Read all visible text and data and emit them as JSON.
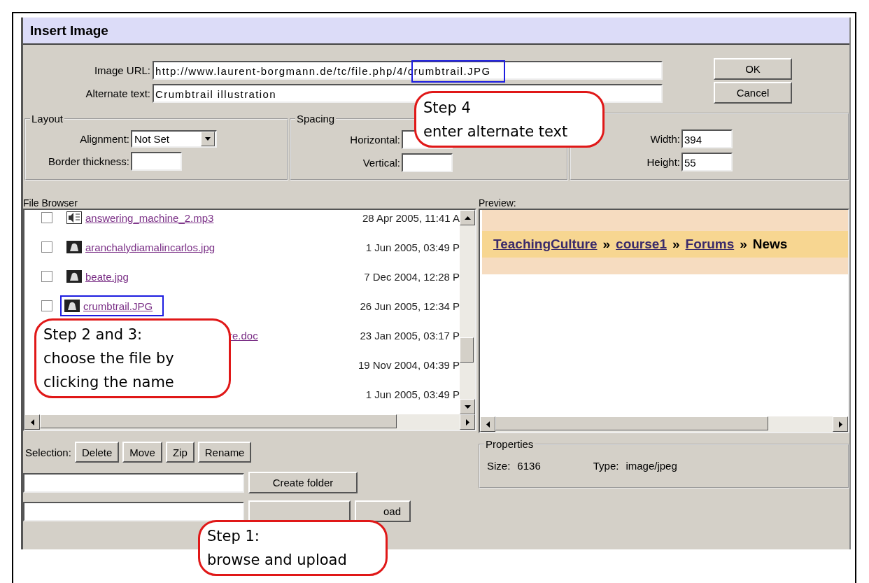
{
  "window": {
    "title": "Insert Image"
  },
  "image_url": {
    "label": "Image URL:",
    "value": "http://www.laurent-borgmann.de/tc/file.php/4/crumbtrail.JPG"
  },
  "alternate_text": {
    "label": "Alternate text:",
    "value": "Crumbtrail illustration"
  },
  "buttons": [
    "OK",
    "Cancel"
  ],
  "layout": {
    "legend": "Layout",
    "alignment_label": "Alignment:",
    "alignment_value": "Not Set",
    "border_label": "Border thickness:"
  },
  "spacing": {
    "legend": "Spacing",
    "horizontal_label": "Horizontal:",
    "vertical_label": "Vertical:"
  },
  "size": {
    "width_label": "Width:",
    "width_value": "394",
    "height_label": "Height:",
    "height_value": "55"
  },
  "file_browser": {
    "label": "File Browser",
    "files": [
      {
        "kind": "audio",
        "name": "answering_machine_2.mp3",
        "date": "28 Apr 2005, 11:41 A",
        "checked": false
      },
      {
        "kind": "image",
        "name": "aranchalydiamalincarlos.jpg",
        "date": "1 Jun 2005, 03:49 P",
        "checked": false
      },
      {
        "kind": "image",
        "name": "beate.jpg",
        "date": "7 Dec 2004, 12:28 P",
        "checked": false
      },
      {
        "kind": "image",
        "name": "crumbtrail.JPG",
        "date": "26 Jun 2005, 12:34 P",
        "checked": false,
        "highlighted": true
      },
      {
        "name": "re.doc",
        "date": "23 Jan 2005, 03:17 P",
        "covered": true
      },
      {
        "date": "19 Nov 2004, 04:39 P"
      },
      {
        "date": "1 Jun 2005, 03:49 P"
      }
    ]
  },
  "preview": {
    "label": "Preview:",
    "breadcrumb": [
      {
        "text": "TeachingCulture",
        "link": true
      },
      {
        "text": "»",
        "link": false
      },
      {
        "text": "course1",
        "link": true
      },
      {
        "text": "»",
        "link": false
      },
      {
        "text": "Forums",
        "link": true
      },
      {
        "text": "»",
        "link": false
      },
      {
        "text": "News",
        "link": false
      }
    ]
  },
  "selection": {
    "label": "Selection:",
    "buttons": [
      "Delete",
      "Move",
      "Zip",
      "Rename"
    ]
  },
  "properties": {
    "legend": "Properties",
    "size_label": "Size:",
    "size_value": "6136",
    "type_label": "Type:",
    "type_value": "image/jpeg"
  },
  "create_folder": {
    "button": "Create folder"
  },
  "upload": {
    "button": "oad"
  },
  "callouts": [
    {
      "kind": "url",
      "lines": [
        "Step 4",
        "enter alternate text"
      ]
    },
    {
      "kind": "file",
      "lines": [
        "Step 2 and 3:",
        "choose the file by",
        "clicking the name"
      ]
    },
    {
      "kind": "upload",
      "lines": [
        "Step 1:",
        "browse and upload"
      ]
    }
  ]
}
